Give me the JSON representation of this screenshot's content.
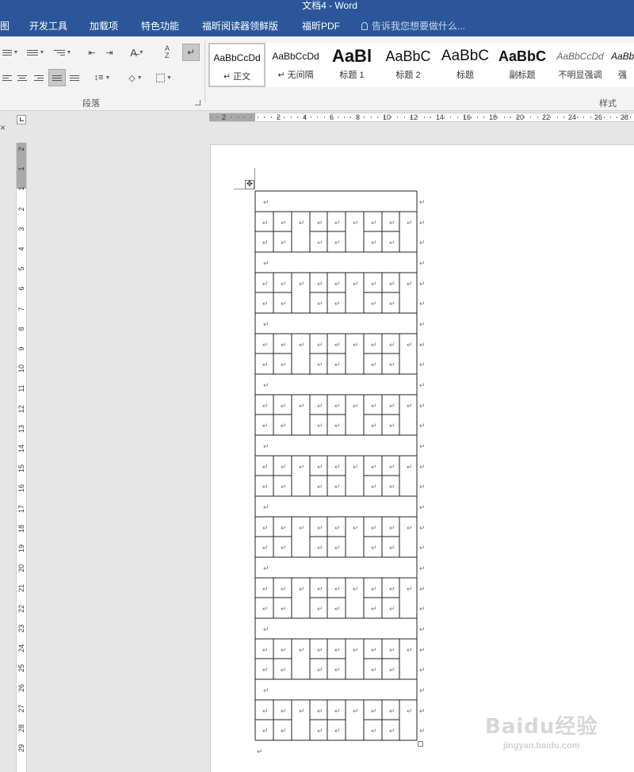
{
  "window": {
    "title": "文档4 - Word"
  },
  "tabs": [
    "图",
    "开发工具",
    "加载项",
    "特色功能",
    "福昕阅读器领鲜版",
    "福昕PDF"
  ],
  "tell_me": {
    "placeholder": "告诉我您想要做什么..."
  },
  "ribbon": {
    "paragraph_group_label": "段落",
    "styles_group_label": "样式",
    "styles": [
      {
        "sample": "AaBbCcDd",
        "name": "↵ 正文",
        "selected": true
      },
      {
        "sample": "AaBbCcDd",
        "name": "↵ 无间隔"
      },
      {
        "sample": "AaBl",
        "name": "标题 1"
      },
      {
        "sample": "AaBbC",
        "name": "标题 2"
      },
      {
        "sample": "AaBbC",
        "name": "标题"
      },
      {
        "sample": "AaBbC",
        "name": "副标题"
      },
      {
        "sample": "AaBbCcDd",
        "name": "不明显强调"
      },
      {
        "sample": "AaBb",
        "name": "强"
      }
    ]
  },
  "horizontal_ruler_labels": [
    "2",
    "2",
    "4",
    "6",
    "8",
    "10",
    "12",
    "14",
    "16",
    "18",
    "20",
    "22",
    "24",
    "26",
    "28"
  ],
  "vertical_ruler_labels": [
    "2",
    "1",
    "1",
    "2",
    "3",
    "4",
    "5",
    "6",
    "7",
    "8",
    "9",
    "10",
    "11",
    "12",
    "13",
    "14",
    "15",
    "16",
    "17",
    "18",
    "19",
    "20",
    "21",
    "22",
    "23",
    "24",
    "25",
    "26",
    "27",
    "28",
    "29"
  ],
  "document": {
    "paragraph_mark": "↵",
    "table": {
      "block_count": 9,
      "block_columns": 9,
      "block_data_rows": 2
    }
  },
  "watermark": {
    "logo": "Baidu经验",
    "url": "jingyan.baidu.com"
  }
}
